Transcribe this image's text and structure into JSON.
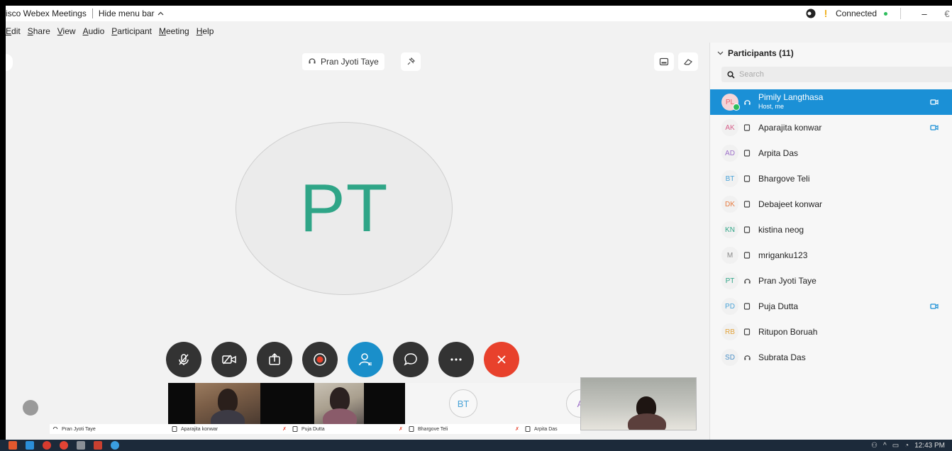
{
  "window": {
    "title": "isco Webex Meetings",
    "hide_menu": "Hide menu bar",
    "connection": "Connected",
    "minimize": "–",
    "more": "€"
  },
  "menu": [
    "Edit",
    "Share",
    "View",
    "Audio",
    "Participant",
    "Meeting",
    "Help"
  ],
  "stage": {
    "active_speaker": "Pran Jyoti Taye",
    "avatar_initials": "PT",
    "avatar_color": "#2fa587"
  },
  "controls": [
    "mute",
    "stop-video",
    "share",
    "record",
    "participants",
    "chat",
    "more",
    "leave"
  ],
  "filmstrip": {
    "labels": [
      "Pran Jyoti Taye",
      "Aparajita konwar",
      "Puja Dutta",
      "Bhargove Teli",
      "Arpita Das"
    ],
    "bt_initials": "BT",
    "a_initials": "A"
  },
  "panel": {
    "title": "Participants (11)",
    "search_placeholder": "Search",
    "participants": [
      {
        "initials": "PL",
        "name": "Pimily Langthasa",
        "role": "Host, me",
        "color": "#e6616b"
      },
      {
        "initials": "AK",
        "name": "Aparajita konwar",
        "role": "",
        "color": "#d65f8a"
      },
      {
        "initials": "AD",
        "name": "Arpita Das",
        "role": "",
        "color": "#9d6fc9"
      },
      {
        "initials": "BT",
        "name": "Bhargove Teli",
        "role": "",
        "color": "#4aa3d8"
      },
      {
        "initials": "DK",
        "name": "Debajeet konwar",
        "role": "",
        "color": "#e77b3f"
      },
      {
        "initials": "KN",
        "name": "kistina neog",
        "role": "",
        "color": "#2fa587"
      },
      {
        "initials": "M",
        "name": "mriganku123",
        "role": "",
        "color": "#888888"
      },
      {
        "initials": "PT",
        "name": "Pran Jyoti Taye",
        "role": "",
        "color": "#2fa587"
      },
      {
        "initials": "PD",
        "name": "Puja Dutta",
        "role": "",
        "color": "#4aa3d8"
      },
      {
        "initials": "RB",
        "name": "Ritupon Boruah",
        "role": "",
        "color": "#e2a33a"
      },
      {
        "initials": "SD",
        "name": "Subrata Das",
        "role": "",
        "color": "#4a8fc7"
      }
    ]
  },
  "taskbar": {
    "time": "12:43 PM"
  }
}
